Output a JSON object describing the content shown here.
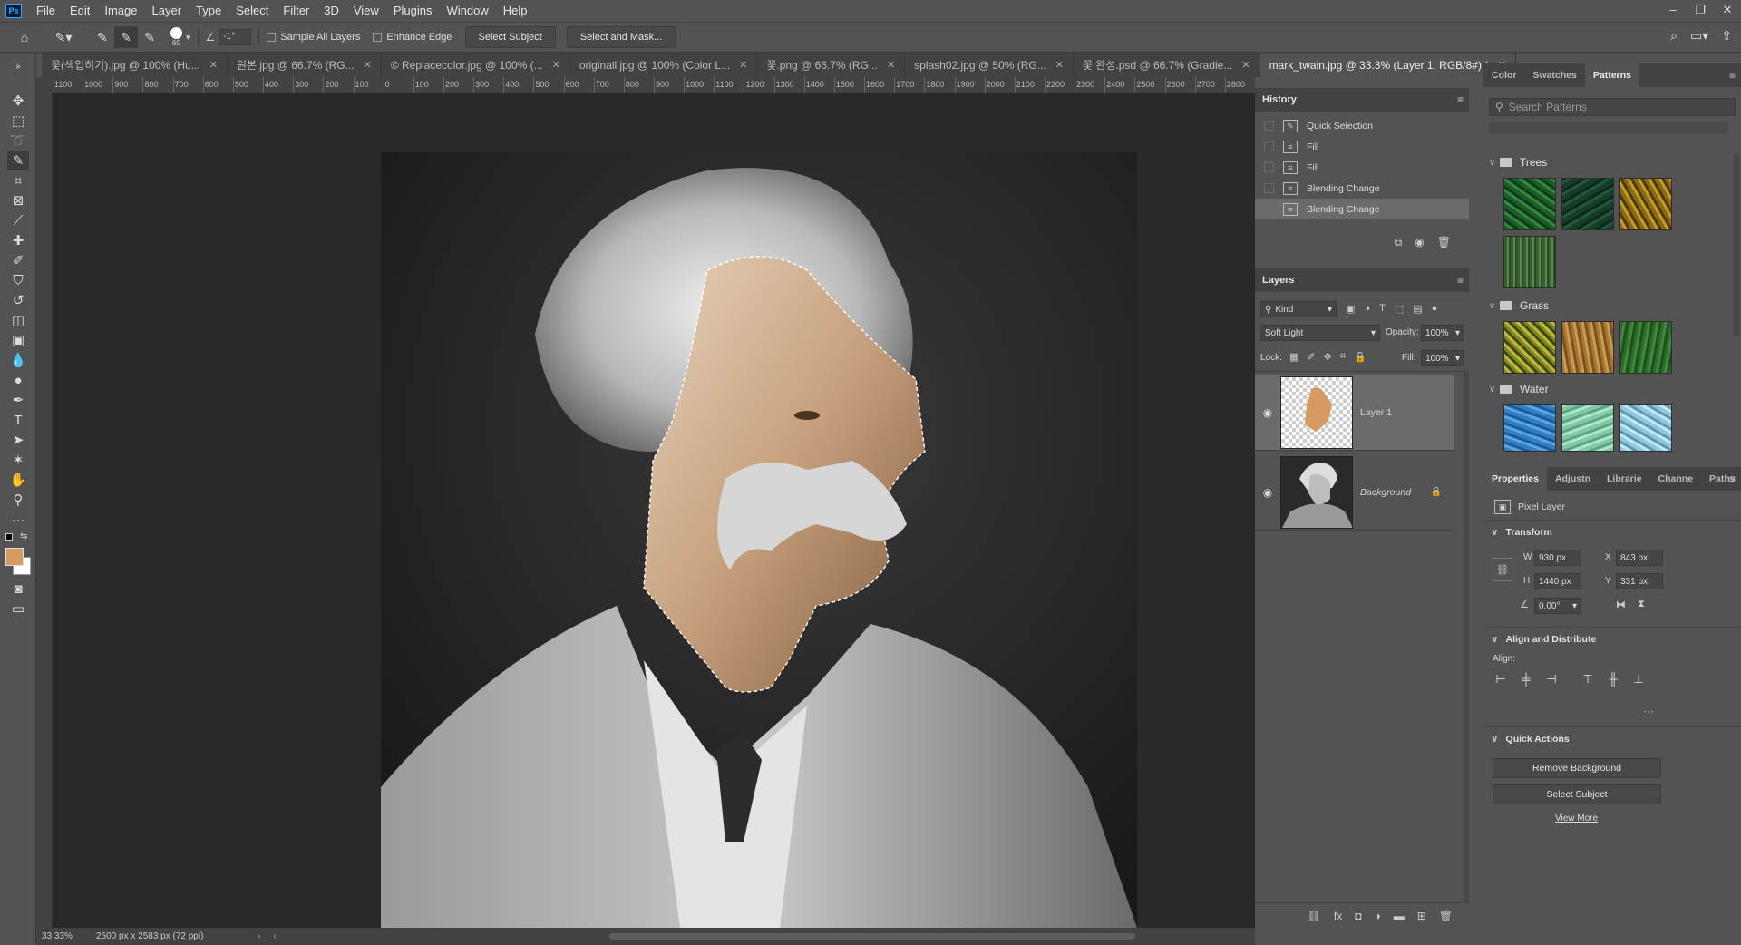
{
  "app": {
    "logo": "Ps"
  },
  "menu": [
    "File",
    "Edit",
    "Image",
    "Layer",
    "Type",
    "Select",
    "Filter",
    "3D",
    "View",
    "Plugins",
    "Window",
    "Help"
  ],
  "window_controls": {
    "minimize": "–",
    "restore": "❐",
    "close": "✕"
  },
  "options": {
    "brush_size": "60",
    "angle": "-1°",
    "sample_all_layers": "Sample All Layers",
    "enhance_edge": "Enhance Edge",
    "select_subject": "Select Subject",
    "select_and_mask": "Select and Mask..."
  },
  "tabs": [
    {
      "label": "꽃(색입히기).jpg @ 100% (Hu..."
    },
    {
      "label": "원본.jpg @ 66.7% (RG..."
    },
    {
      "label": "© Replacecolor.jpg @ 100% (..."
    },
    {
      "label": "originall.jpg @ 100% (Color L..."
    },
    {
      "label": "꽃.png @ 66.7% (RG..."
    },
    {
      "label": "splash02.jpg @ 50% (RG..."
    },
    {
      "label": "꽃 완성.psd @ 66.7% (Gradie..."
    },
    {
      "label": "mark_twain.jpg @ 33.3% (Layer 1, RGB/8#) *"
    }
  ],
  "ruler_h_ticks": [
    "1100",
    "1000",
    "900",
    "800",
    "700",
    "600",
    "500",
    "400",
    "300",
    "200",
    "100",
    "0",
    "100",
    "200",
    "300",
    "400",
    "500",
    "600",
    "700",
    "800",
    "900",
    "1000",
    "1100",
    "1200",
    "1300",
    "1400",
    "1500",
    "1600",
    "1700",
    "1800",
    "1900",
    "2000",
    "2100",
    "2200",
    "2300",
    "2400",
    "2500",
    "2600",
    "2700",
    "2800"
  ],
  "status": {
    "zoom": "33.33%",
    "doc_info": "2500 px x 2583 px (72 ppi)"
  },
  "history": {
    "title": "History",
    "items": [
      {
        "label": "Quick Selection",
        "selected": false
      },
      {
        "label": "Fill",
        "selected": false
      },
      {
        "label": "Fill",
        "selected": false
      },
      {
        "label": "Blending Change",
        "selected": false
      },
      {
        "label": "Blending Change",
        "selected": true
      }
    ]
  },
  "layers": {
    "title": "Layers",
    "filter_kind": "Kind",
    "blend_mode": "Soft Light",
    "opacity_label": "Opacity:",
    "opacity": "100%",
    "lock_label": "Lock:",
    "fill_label": "Fill:",
    "fill": "100%",
    "items": [
      {
        "name": "Layer 1",
        "selected": true,
        "italic": false
      },
      {
        "name": "Background",
        "selected": false,
        "italic": true
      }
    ]
  },
  "patterns": {
    "tabs": [
      "Color",
      "Swatches",
      "Patterns"
    ],
    "active_tab": "Patterns",
    "search_placeholder": "Search Patterns",
    "groups": [
      {
        "name": "Trees",
        "colors": [
          "#1f5a2a",
          "#173d2a",
          "#8a6a14",
          "#3b5e35"
        ]
      },
      {
        "name": "Grass",
        "colors": [
          "#7a8a22",
          "#a8742e",
          "#2d6d2a"
        ]
      },
      {
        "name": "Water",
        "colors": [
          "#2e7fc4",
          "#7fc9a6",
          "#8ec8dc"
        ]
      }
    ]
  },
  "properties": {
    "tabs": [
      "Properties",
      "Adjustn",
      "Librarie",
      "Channe",
      "Paths"
    ],
    "active_tab": "Properties",
    "layer_type": "Pixel Layer",
    "transform_title": "Transform",
    "w_label": "W",
    "w": "930 px",
    "x_label": "X",
    "x": "843 px",
    "h_label": "H",
    "h": "1440 px",
    "y_label": "Y",
    "y": "331 px",
    "angle": "0.00°",
    "align_title": "Align and Distribute",
    "align_label": "Align:",
    "quick_actions_title": "Quick Actions",
    "remove_background": "Remove Background",
    "select_subject": "Select Subject",
    "view_more": "View More"
  },
  "colors": {
    "foreground": "#d79a62",
    "background": "#ffffff",
    "accent": "#31a8ff"
  }
}
